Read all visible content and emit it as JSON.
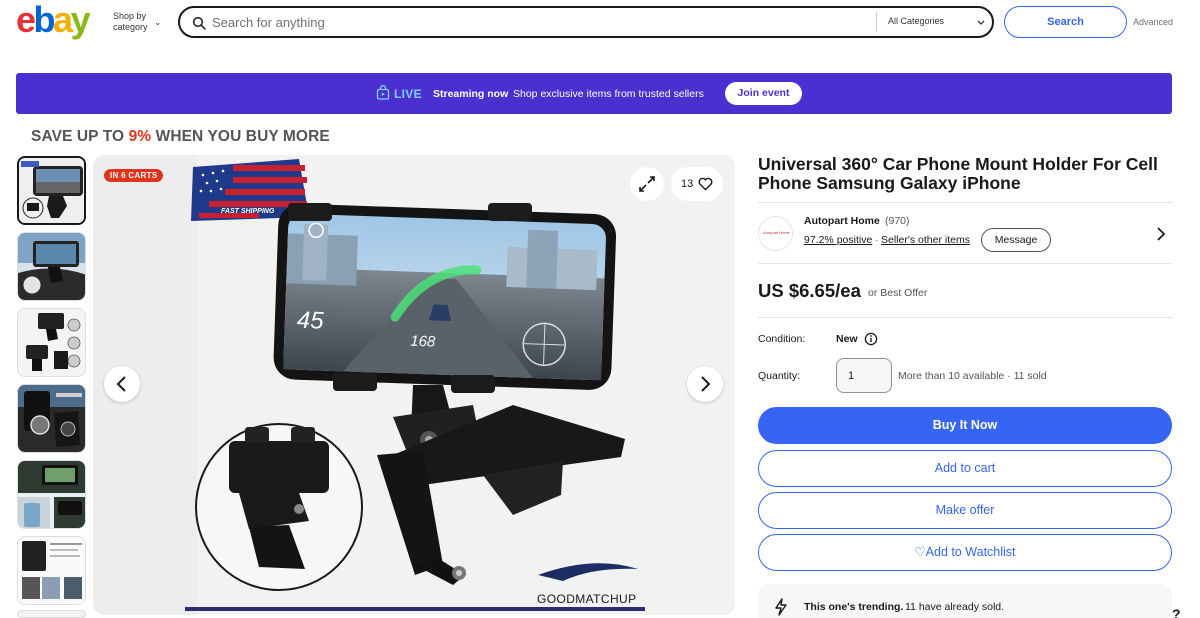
{
  "header": {
    "logo_text": "ebay",
    "shop_by_line1": "Shop by",
    "shop_by_line2": "category",
    "search_placeholder": "Search for anything",
    "category_select": "All Categories",
    "search_button": "Search",
    "advanced_link": "Advanced"
  },
  "banner": {
    "live_label": "LIVE",
    "streaming_text": "Streaming now",
    "description": "Shop exclusive items from trusted sellers",
    "join_button": "Join event",
    "background_color": "#4b2fd0"
  },
  "promo": {
    "prefix": "SAVE UP TO ",
    "percent": "9%",
    "suffix": " WHEN YOU BUY MORE"
  },
  "gallery": {
    "thumbnail_count": 6,
    "selected_index": 0,
    "cart_badge": "IN 6 CARTS",
    "watch_count": "13",
    "flag_caption": "FAST SHIPPING",
    "brand_watermark": "GOODMATCHUP",
    "screen_speed": "45",
    "screen_distance": "168"
  },
  "listing": {
    "title": "Universal 360° Car Phone Mount Holder For Cell Phone Samsung Galaxy iPhone",
    "seller": {
      "name": "Autopart Home",
      "feedback_count": "(970)",
      "positive": "97.2% positive",
      "other_items": "Seller's other items",
      "message_button": "Message"
    },
    "price": "US $6.65/ea",
    "best_offer": "or Best Offer",
    "condition_label": "Condition:",
    "condition_value": "New",
    "quantity_label": "Quantity:",
    "quantity_value": "1",
    "availability": "More than 10 available · 11 sold",
    "buy_now": "Buy It Now",
    "add_to_cart": "Add to cart",
    "make_offer": "Make offer",
    "add_to_watchlist": "Add to Watchlist",
    "trending_bold": "This one's trending.",
    "trending_text": "11 have already sold.",
    "accent_color": "#3665f3"
  }
}
